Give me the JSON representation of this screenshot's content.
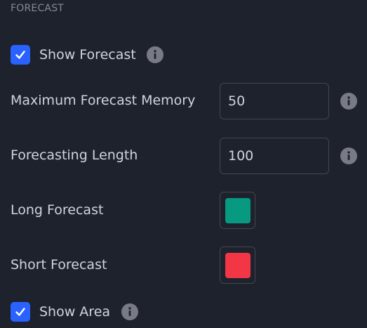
{
  "section": {
    "title": "FORECAST"
  },
  "show_forecast": {
    "label": "Show Forecast",
    "checked": true
  },
  "max_forecast_memory": {
    "label": "Maximum Forecast Memory",
    "value": "50"
  },
  "forecasting_length": {
    "label": "Forecasting Length",
    "value": "100"
  },
  "long_forecast": {
    "label": "Long Forecast",
    "color": "#089981"
  },
  "short_forecast": {
    "label": "Short Forecast",
    "color": "#f23645"
  },
  "show_area": {
    "label": "Show Area",
    "checked": true
  },
  "icons": {
    "check": "check-icon",
    "info": "info-icon"
  },
  "colors": {
    "background": "#1e222d",
    "accent": "#2962ff",
    "text": "#d1d4dc",
    "muted": "#868993",
    "border": "#434651"
  }
}
